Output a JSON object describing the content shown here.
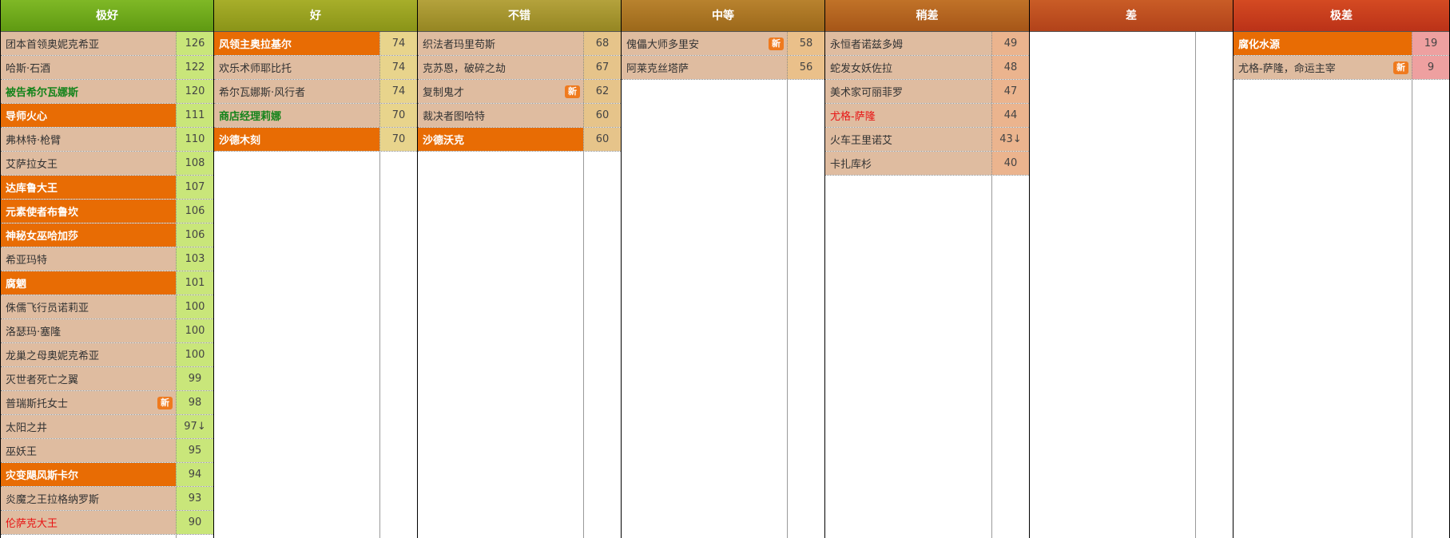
{
  "tiers": [
    {
      "label": "极好",
      "header_color": "#7fb826",
      "score_bg": "#c9e67a",
      "items": [
        {
          "name": "团本首领奥妮克希亚",
          "score": "126",
          "style": ""
        },
        {
          "name": "哈斯·石酒",
          "score": "122",
          "style": ""
        },
        {
          "name": "被告希尔瓦娜斯",
          "score": "120",
          "style": "green"
        },
        {
          "name": "导师火心",
          "score": "111",
          "style": "hl"
        },
        {
          "name": "弗林特·枪臂",
          "score": "110",
          "style": ""
        },
        {
          "name": "艾萨拉女王",
          "score": "108",
          "style": ""
        },
        {
          "name": "达库鲁大王",
          "score": "107",
          "style": "hl"
        },
        {
          "name": "元素使者布鲁坎",
          "score": "106",
          "style": "hl"
        },
        {
          "name": "神秘女巫哈加莎",
          "score": "106",
          "style": "hl"
        },
        {
          "name": "希亚玛特",
          "score": "103",
          "style": ""
        },
        {
          "name": "腐魍",
          "score": "101",
          "style": "hl"
        },
        {
          "name": "侏儒飞行员诺莉亚",
          "score": "100",
          "style": ""
        },
        {
          "name": "洛瑟玛·塞隆",
          "score": "100",
          "style": ""
        },
        {
          "name": "龙巢之母奥妮克希亚",
          "score": "100",
          "style": ""
        },
        {
          "name": "灭世者死亡之翼",
          "score": "99",
          "style": ""
        },
        {
          "name": "普瑞斯托女士",
          "score": "98",
          "style": "",
          "badge": "新"
        },
        {
          "name": "太阳之井",
          "score": "97↓",
          "style": ""
        },
        {
          "name": "巫妖王",
          "score": "95",
          "style": ""
        },
        {
          "name": "灾变飓风斯卡尔",
          "score": "94",
          "style": "hl"
        },
        {
          "name": "炎魔之王拉格纳罗斯",
          "score": "93",
          "style": ""
        },
        {
          "name": "伦萨克大王",
          "score": "90",
          "style": "red"
        }
      ]
    },
    {
      "label": "好",
      "header_color": "#a7ae2a",
      "score_bg": "#e8d48c",
      "items": [
        {
          "name": "风领主奥拉基尔",
          "score": "74",
          "style": "hl"
        },
        {
          "name": "欢乐术师耶比托",
          "score": "74",
          "style": ""
        },
        {
          "name": "希尔瓦娜斯·风行者",
          "score": "74",
          "style": ""
        },
        {
          "name": "商店经理莉娜",
          "score": "70",
          "style": "green"
        },
        {
          "name": "沙德木刻",
          "score": "70",
          "style": "hl"
        }
      ]
    },
    {
      "label": "不错",
      "header_color": "#b4a23c",
      "score_bg": "#e6c48a",
      "items": [
        {
          "name": "织法者玛里苟斯",
          "score": "68",
          "style": ""
        },
        {
          "name": "克苏恩，破碎之劫",
          "score": "67",
          "style": ""
        },
        {
          "name": "复制鬼才",
          "score": "62",
          "style": "",
          "badge": "新"
        },
        {
          "name": "裁决者图哈特",
          "score": "60",
          "style": ""
        },
        {
          "name": "沙德沃克",
          "score": "60",
          "style": "hl"
        }
      ]
    },
    {
      "label": "中等",
      "header_color": "#b8822e",
      "score_bg": "#eac08a",
      "items": [
        {
          "name": "傀儡大师多里安",
          "score": "58",
          "style": "",
          "badge": "新"
        },
        {
          "name": "阿莱克丝塔萨",
          "score": "56",
          "style": ""
        }
      ]
    },
    {
      "label": "稍差",
      "header_color": "#c07228",
      "score_bg": "#ebb48e",
      "items": [
        {
          "name": "永恒者诺兹多姆",
          "score": "49",
          "style": ""
        },
        {
          "name": "蛇发女妖佐拉",
          "score": "48",
          "style": ""
        },
        {
          "name": "美术家可丽菲罗",
          "score": "47",
          "style": ""
        },
        {
          "name": "尤格-萨隆",
          "score": "44",
          "style": "red"
        },
        {
          "name": "火车王里诺艾",
          "score": "43↓",
          "style": ""
        },
        {
          "name": "卡扎库杉",
          "score": "40",
          "style": ""
        }
      ]
    },
    {
      "label": "差",
      "header_color": "#c95c26",
      "score_bg": "#eea890",
      "items": []
    },
    {
      "label": "极差",
      "header_color": "#d44a22",
      "score_bg": "#eea0a0",
      "items": [
        {
          "name": "腐化水源",
          "score": "19",
          "style": "hl"
        },
        {
          "name": "尤格-萨隆，命运主宰",
          "score": "9",
          "style": "",
          "badge": "新"
        }
      ]
    }
  ]
}
